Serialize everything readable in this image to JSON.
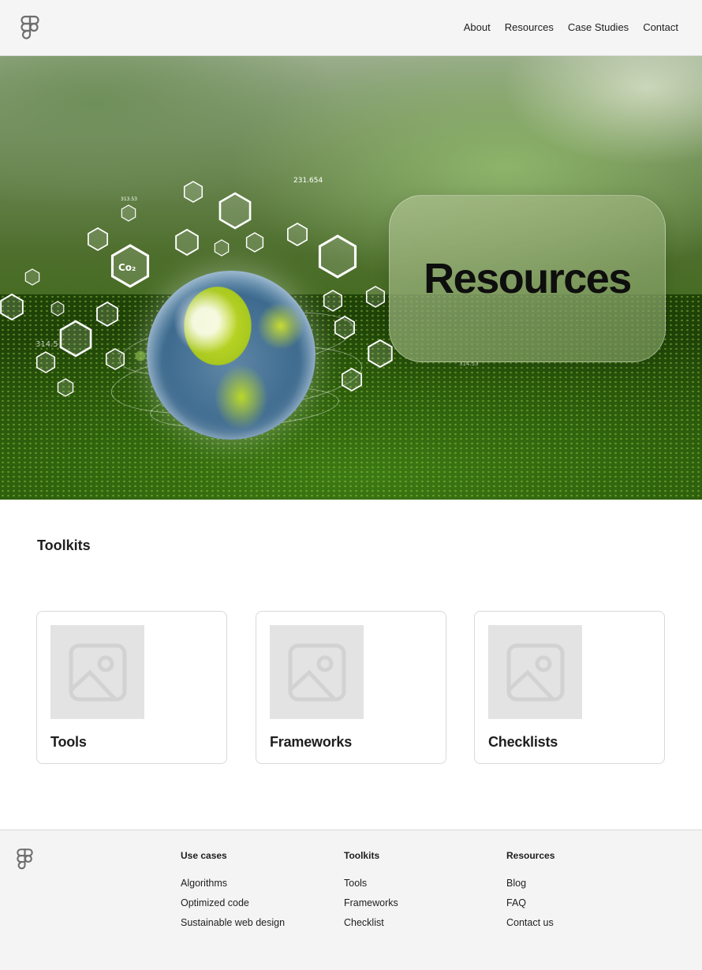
{
  "header": {
    "nav": [
      "About",
      "Resources",
      "Case Studies",
      "Contact"
    ]
  },
  "hero": {
    "title": "Resources",
    "overlay_numbers": [
      "231.654",
      "313.53",
      "314.5",
      "314.53"
    ],
    "overlay_co2": "Co₂"
  },
  "toolkits": {
    "heading": "Toolkits",
    "cards": [
      {
        "label": "Tools"
      },
      {
        "label": "Frameworks"
      },
      {
        "label": "Checklists"
      }
    ]
  },
  "footer": {
    "columns": [
      {
        "heading": "Use cases",
        "links": [
          "Algorithms",
          "Optimized code",
          "Sustainable web design"
        ]
      },
      {
        "heading": "Toolkits",
        "links": [
          "Tools",
          "Frameworks",
          "Checklist"
        ]
      },
      {
        "heading": "Resources",
        "links": [
          "Blog",
          "FAQ",
          "Contact us"
        ]
      }
    ]
  },
  "colors": {
    "header_bg": "#f5f5f5",
    "footer_bg": "#f4f4f4",
    "placeholder": "#e3e3e3",
    "text": "#1e1e1e"
  }
}
